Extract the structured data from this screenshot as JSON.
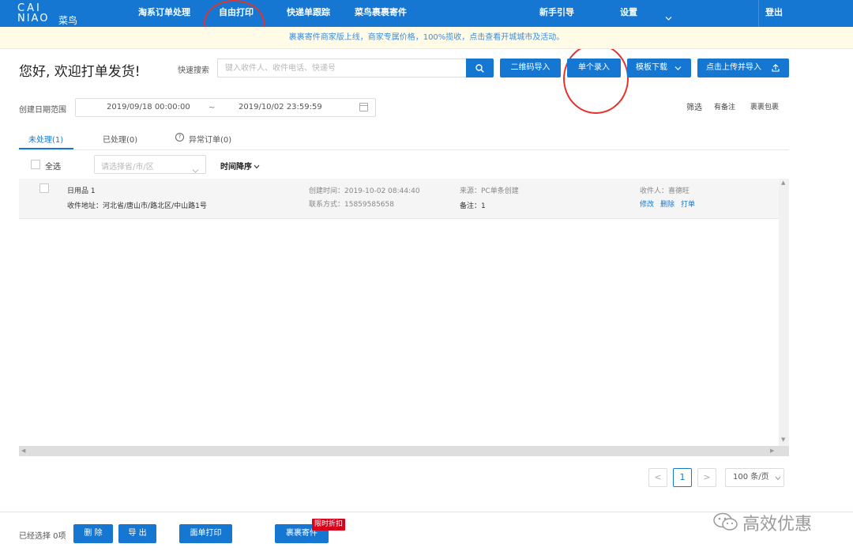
{
  "logo": {
    "line1": "CAI",
    "line2": "NIAO",
    "cn": "菜鸟"
  },
  "nav": {
    "items": [
      "淘系订单处理",
      "自由打印",
      "快递单跟踪",
      "菜鸟裹裹寄件",
      "新手引导",
      "设置"
    ],
    "logout": "登出"
  },
  "notice": "裹裹寄件商家版上线，商家专属价格，100%揽收，点击查看开城城市及活动。",
  "header": {
    "greeting": "您好, 欢迎打单发货!",
    "quick_search_label": "快速搜索",
    "search_placeholder": "键入收件人、收件电话、快递号",
    "buttons": {
      "qr_import": "二维码导入",
      "single_entry": "单个录入",
      "template_download": "模板下载",
      "upload_import": "点击上传并导入"
    }
  },
  "filter": {
    "date_label": "创建日期范围",
    "date_start": "2019/09/18 00:00:00",
    "date_sep": "~",
    "date_end": "2019/10/02 23:59:59",
    "filter_label": "筛选",
    "has_note": "有备注",
    "package": "裹裹包裹"
  },
  "tabs": [
    {
      "label": "未处理(1)",
      "active": true
    },
    {
      "label": "已处理(0)",
      "active": false
    },
    {
      "label": "异常订单(0)",
      "active": false
    }
  ],
  "toolbar": {
    "select_all": "全选",
    "region_placeholder": "请选择省/市/区",
    "sort": "时间降序"
  },
  "orders": [
    {
      "product": "日用品 1",
      "address": "收件地址：河北省/唐山市/路北区/中山路1号",
      "created": "创建时间：2019-10-02 08:44:40",
      "contact": "联系方式：15859585658",
      "source": "来源：PC单条创建",
      "note": "备注：1",
      "recipient": "收件人：喜德旺",
      "actions": {
        "edit": "修改",
        "delete": "删除",
        "print": "打单"
      }
    }
  ],
  "pagination": {
    "prev": "<",
    "current": "1",
    "next": ">",
    "page_size": "100 条/页"
  },
  "footer": {
    "selected": "已经选择 0项",
    "buttons": {
      "delete": "删 除",
      "export": "导 出",
      "print_sheet": "面单打印",
      "guoguo_send": "裹裹寄件"
    },
    "badge": "限时折扣"
  },
  "watermark": "高效优惠",
  "colors": {
    "primary": "#1677d2",
    "notice_bg": "#fffbe6",
    "annotation": "#e5322d",
    "badge": "#d9001b"
  }
}
